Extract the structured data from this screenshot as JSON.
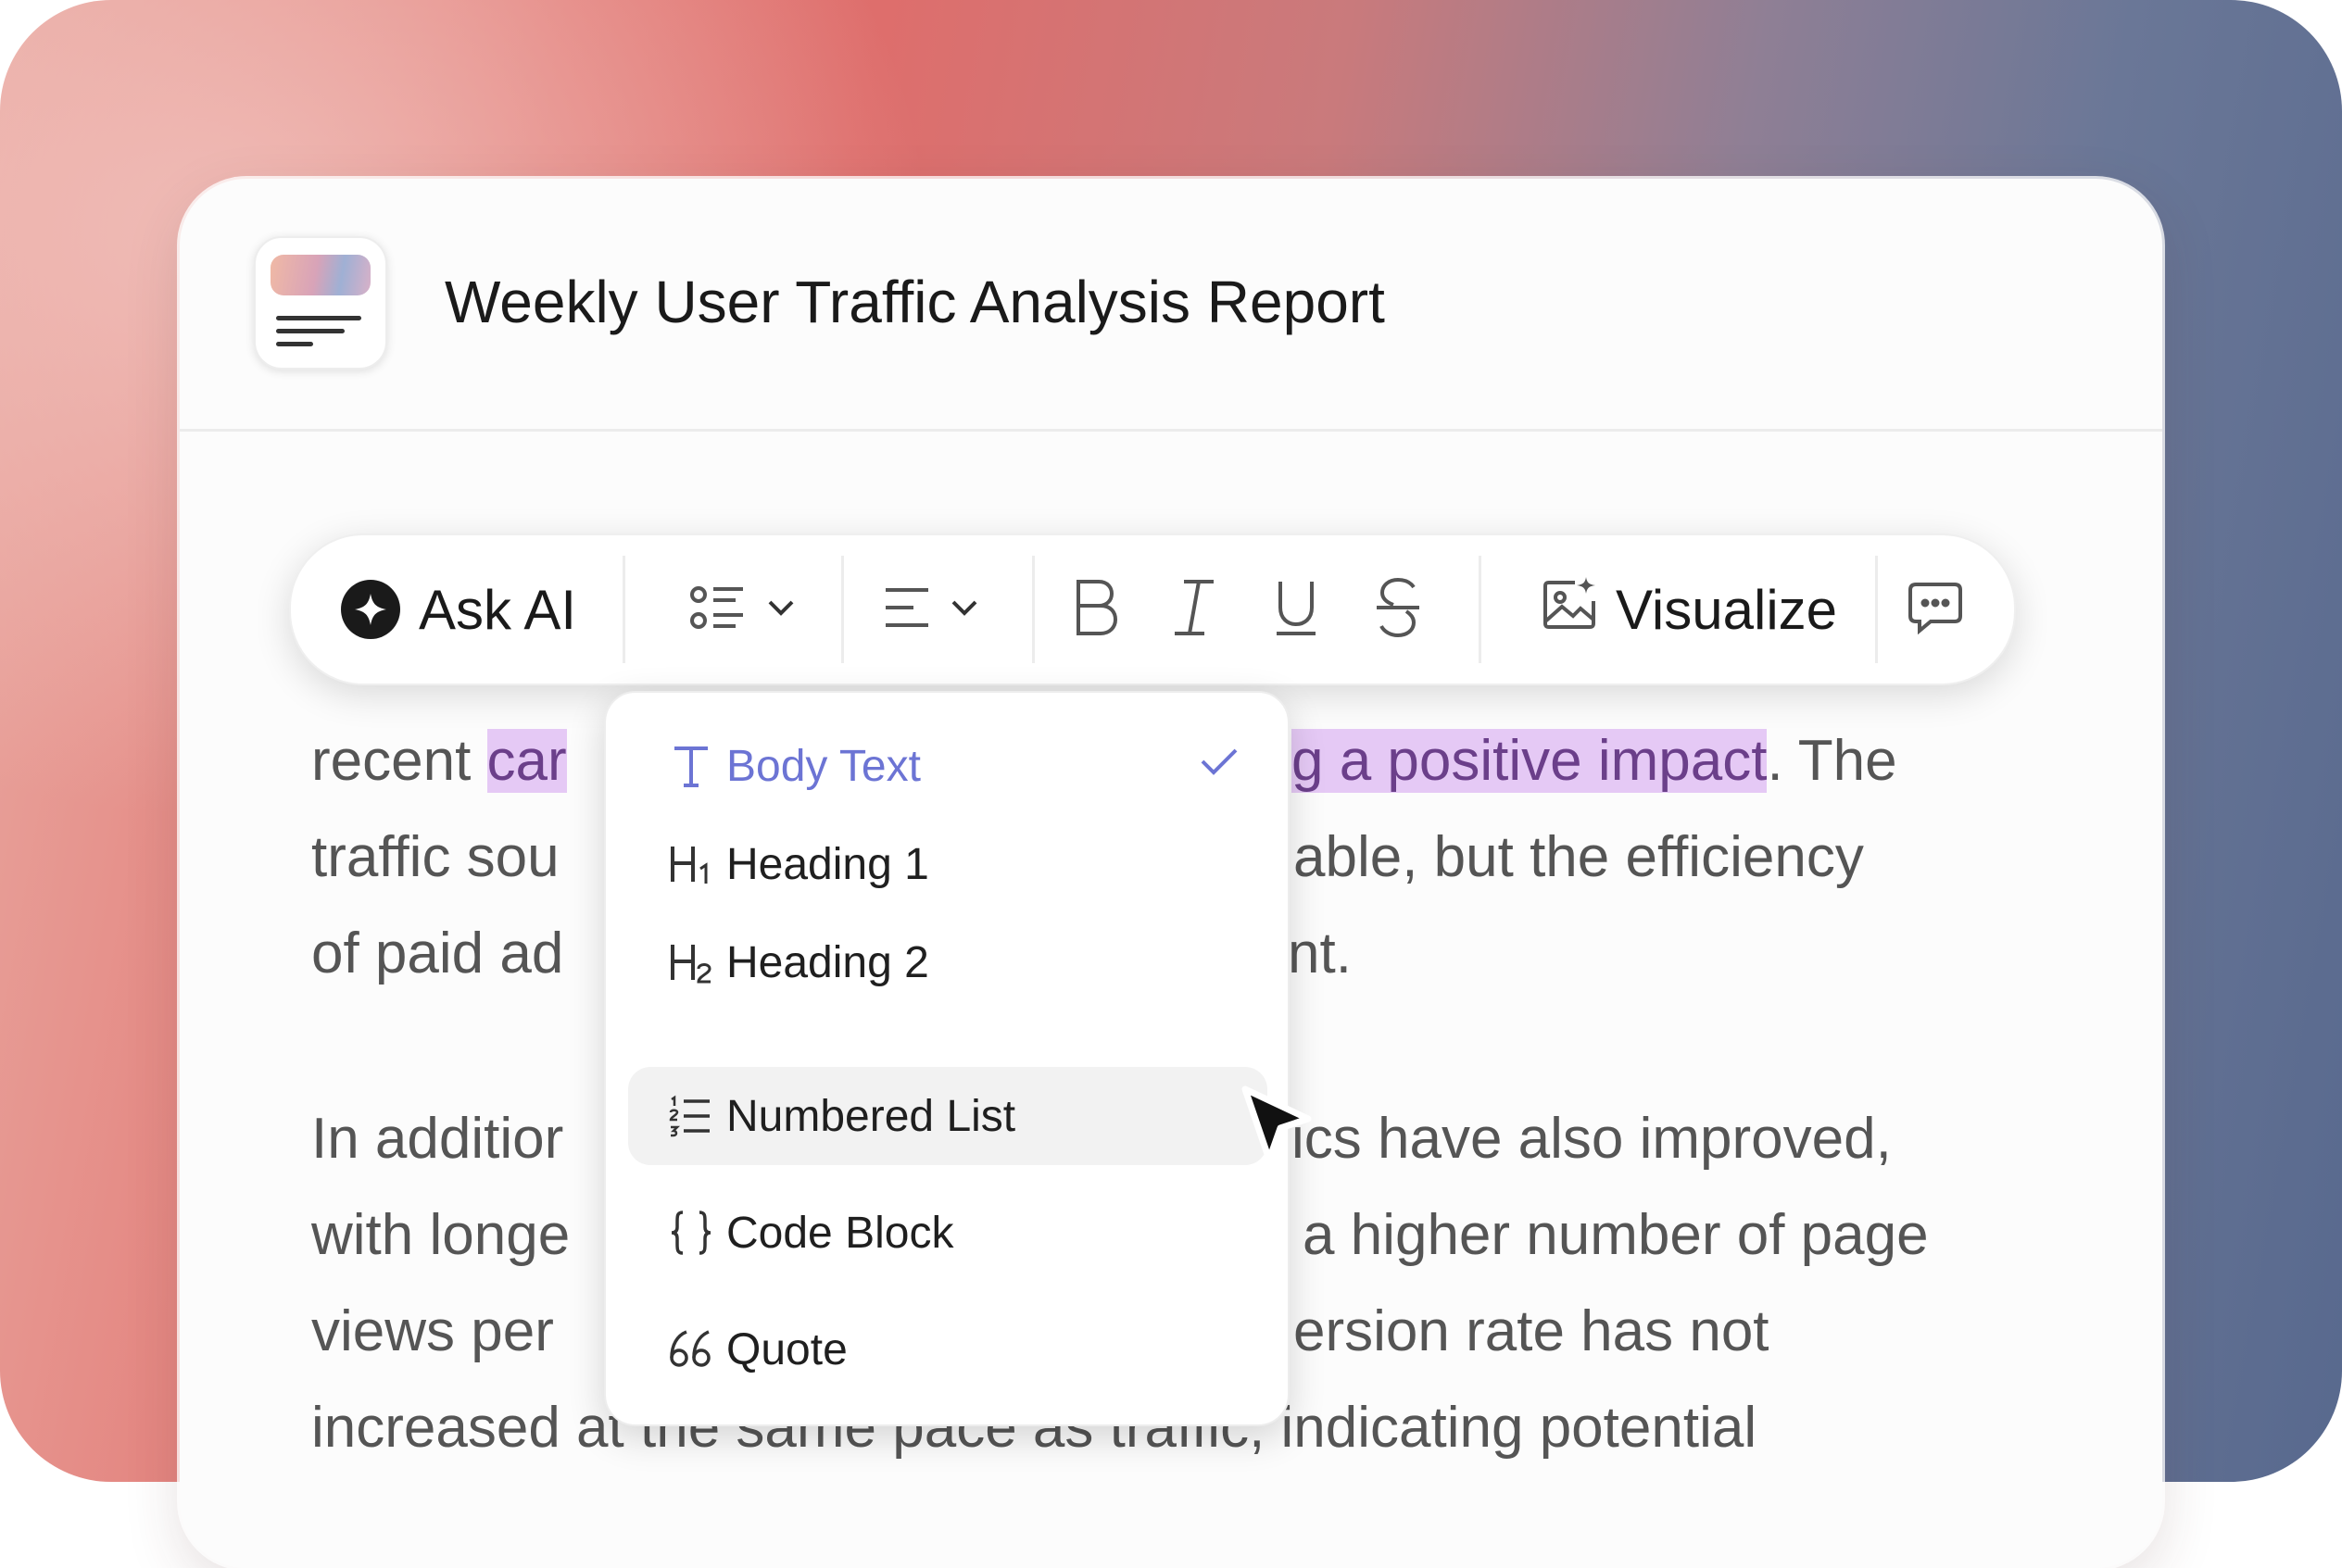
{
  "doc": {
    "title": "Weekly User Traffic Analysis Report",
    "icon": "document-icon"
  },
  "body": {
    "line1_pre": "recent ",
    "line1_hl_a": "car",
    "line1_hl_b": "g a positive impact",
    "line1_post": ". The",
    "line2_a": "traffic sou",
    "line2_b": "able, but the efficiency",
    "line3_a": "of paid ad",
    "line3_b": "nt.",
    "line4_a": "In additior",
    "line4_b": "ics have also improved,",
    "line5_a": "with longe",
    "line5_b": "a higher number of page",
    "line6_a": "views per",
    "line6_b": "ersion rate has not",
    "line7": "increased at the same pace as traffic, indicating potential"
  },
  "toolbar": {
    "ask_ai": "Ask AI",
    "visualize": "Visualize",
    "icons": [
      "sparkle-icon",
      "list-style-icon",
      "chevron-down-icon",
      "align-icon",
      "bold-icon",
      "italic-icon",
      "underline-icon",
      "strikethrough-icon",
      "image-sparkle-icon",
      "comment-icon"
    ]
  },
  "menu": {
    "items": [
      {
        "label": "Body Text",
        "icon": "text-icon",
        "selected": true
      },
      {
        "label": "Heading 1",
        "icon": "heading-1-icon"
      },
      {
        "label": "Heading 2",
        "icon": "heading-2-icon"
      },
      {
        "label": "Numbered List",
        "icon": "numbered-list-icon",
        "hovered": true
      },
      {
        "label": "Code Block",
        "icon": "code-block-icon"
      },
      {
        "label": "Quote",
        "icon": "quote-icon"
      }
    ]
  },
  "colors": {
    "selected_text": "#6c74d4",
    "highlight": "#e5c9f5"
  }
}
